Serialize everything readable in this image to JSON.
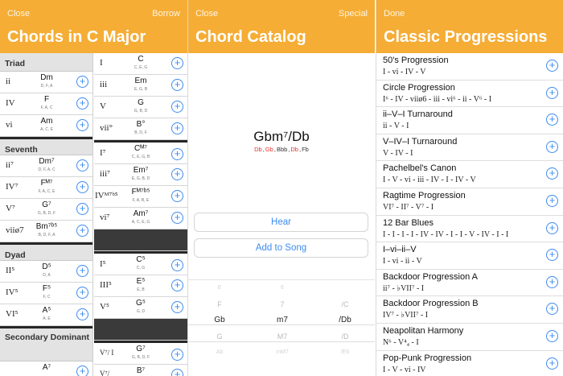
{
  "colors": {
    "header": "#f5ad35",
    "accent": "#3d8bf0",
    "flat_note": "#e03030"
  },
  "panel1": {
    "close": "Close",
    "borrow": "Borrow",
    "title": "Chords in C Major",
    "left": {
      "triad_label": "Triad",
      "triad": [
        {
          "roman": "ii",
          "name": "Dm",
          "notes": "D, F, A"
        },
        {
          "roman": "IV",
          "name": "F",
          "notes": "F, A, C"
        },
        {
          "roman": "vi",
          "name": "Am",
          "notes": "A, C, E"
        }
      ],
      "seventh_label": "Seventh",
      "seventh": [
        {
          "roman": "ii⁷",
          "name": "Dm⁷",
          "notes": "D, F, A, C"
        },
        {
          "roman": "IV⁷",
          "name": "Fᴹ⁷",
          "notes": "F, A, C, E"
        },
        {
          "roman": "V⁷",
          "name": "G⁷",
          "notes": "G, B, D, F"
        },
        {
          "roman": "viiø7",
          "name": "Bm⁷ᵇ⁵",
          "notes": "B, D, F, A"
        }
      ],
      "dyad_label": "Dyad",
      "dyad": [
        {
          "roman": "II⁵",
          "name": "D⁵",
          "notes": "D, A"
        },
        {
          "roman": "IV⁵",
          "name": "F⁵",
          "notes": "F, C"
        },
        {
          "roman": "VI⁵",
          "name": "A⁵",
          "notes": "A, E"
        }
      ],
      "secondary_label": "Secondary Dominant",
      "secondary": [
        {
          "roman": "",
          "name": "A⁷",
          "notes": ""
        }
      ]
    },
    "right": {
      "triad": [
        {
          "roman": "I",
          "name": "C",
          "notes": "C, E, G"
        },
        {
          "roman": "iii",
          "name": "Em",
          "notes": "E, G, B"
        },
        {
          "roman": "V",
          "name": "G",
          "notes": "G, B, D"
        },
        {
          "roman": "vii°",
          "name": "B°",
          "notes": "B, D, F"
        }
      ],
      "seventh": [
        {
          "roman": "I⁷",
          "name": "Cᴹ⁷",
          "notes": "C, E, G, B"
        },
        {
          "roman": "iii⁷",
          "name": "Em⁷",
          "notes": "E, G, B, D"
        },
        {
          "roman": "IVᴹ⁷ᵇ⁵",
          "name": "Fᴹ⁷ᵇ⁵",
          "notes": "F, A, B, E"
        },
        {
          "roman": "vi⁷",
          "name": "Am⁷",
          "notes": "A, C, E, G"
        }
      ],
      "dyad": [
        {
          "roman": "I⁵",
          "name": "C⁵",
          "notes": "C, G"
        },
        {
          "roman": "III⁵",
          "name": "E⁵",
          "notes": "E, B"
        },
        {
          "roman": "V⁵",
          "name": "G⁵",
          "notes": "G, D"
        }
      ],
      "secondary": [
        {
          "roman": "V⁷/ I",
          "name": "G⁷",
          "notes": "G, B, D, F"
        },
        {
          "roman": "V⁷/",
          "name": "B⁷",
          "notes": ""
        }
      ]
    }
  },
  "panel2": {
    "close": "Close",
    "special": "Special",
    "title": "Chord Catalog",
    "chord_name": "Gbm⁷/Db",
    "chord_notes": [
      {
        "text": "Db",
        "flat": true
      },
      {
        "text": "Gb",
        "flat": true
      },
      {
        "text": "Bbb",
        "flat": false
      },
      {
        "text": "Db",
        "flat": true
      },
      {
        "text": "Fb",
        "flat": false
      }
    ],
    "hear": "Hear",
    "add": "Add to Song",
    "picker": {
      "roots": [
        "E",
        "F",
        "Gb",
        "G",
        "Ab"
      ],
      "qualities": [
        "6",
        "7",
        "m7",
        "M7",
        "mM7"
      ],
      "bass": [
        "",
        "/C",
        "/Db",
        "/D",
        "/Eb"
      ],
      "selected_index": 2
    }
  },
  "panel3": {
    "done": "Done",
    "title": "Classic Progressions",
    "items": [
      {
        "name": "50's Progression",
        "chords": "I - vi - IV - V"
      },
      {
        "name": "Circle Progression",
        "chords": "I⁶ - IV - viiø6 - iii - vi⁶ - ii - V⁶ - I"
      },
      {
        "name": "ii–V–I Turnaround",
        "chords": "ii - V - I"
      },
      {
        "name": "V–IV–I Turnaround",
        "chords": "V - IV - I"
      },
      {
        "name": "Pachelbel's Canon",
        "chords": "I - V - vi - iii - IV - I - IV - V"
      },
      {
        "name": "Ragtime Progression",
        "chords": "VI⁷ - II⁷ - V⁷ - I"
      },
      {
        "name": "12 Bar Blues",
        "chords": "I - I - I - I - IV - IV - I - I - V - IV - I - I"
      },
      {
        "name": "I–vi–ii–V",
        "chords": "I - vi - ii - V"
      },
      {
        "name": "Backdoor Progression A",
        "chords": "ii⁷ - ♭VII⁷ - I"
      },
      {
        "name": "Backdoor Progression B",
        "chords": "IV⁷ - ♭VII⁷ - I"
      },
      {
        "name": "Neapolitan Harmony",
        "chords": "N⁶ - V⁴₄ - I"
      },
      {
        "name": "Pop-Punk Progression",
        "chords": "I - V - vi - IV"
      }
    ]
  }
}
